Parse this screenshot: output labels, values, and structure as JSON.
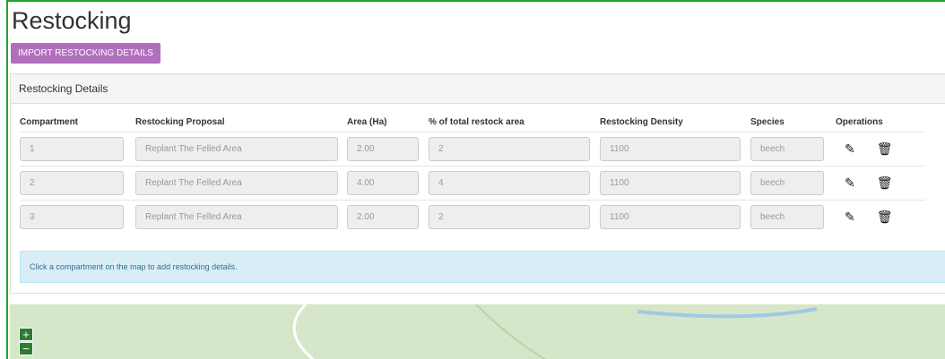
{
  "title": "Restocking",
  "import_label": "IMPORT RESTOCKING DETAILS",
  "panel_title": "Restocking Details",
  "columns": [
    "Compartment",
    "Restocking Proposal",
    "Area (Ha)",
    "% of total restock area",
    "Restocking Density",
    "Species",
    "Operations"
  ],
  "rows": [
    [
      "1",
      "Replant The Felled Area",
      "2.00",
      "2",
      "1100",
      "beech"
    ],
    [
      "2",
      "Replant The Felled Area",
      "4.00",
      "4",
      "1100",
      "beech"
    ],
    [
      "3",
      "Replant The Felled Area",
      "2.00",
      "2",
      "1100",
      "beech"
    ]
  ],
  "info": "Click a compartment on the map to add restocking details.",
  "zoom": {
    "in": "+",
    "out": "−"
  },
  "icons": {
    "edit": "pencil-icon",
    "delete": "trash-icon"
  }
}
